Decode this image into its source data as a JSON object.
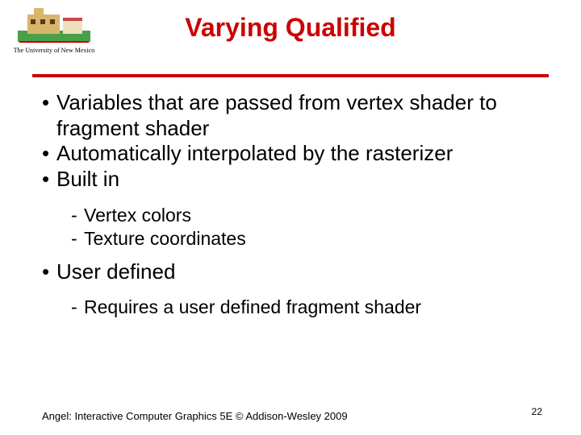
{
  "logo": {
    "caption": "The University of New Mexico"
  },
  "title": "Varying Qualified",
  "bullets": {
    "b1": "Variables that are passed from vertex shader to fragment shader",
    "b2": "Automatically interpolated by the rasterizer",
    "b3": "Built in",
    "b3_subs": {
      "s1": "Vertex colors",
      "s2": "Texture coordinates"
    },
    "b4": "User defined",
    "b4_subs": {
      "s1": "Requires a user defined fragment shader"
    }
  },
  "footer": "Angel: Interactive Computer Graphics 5E © Addison-Wesley 2009",
  "page_number": "22"
}
